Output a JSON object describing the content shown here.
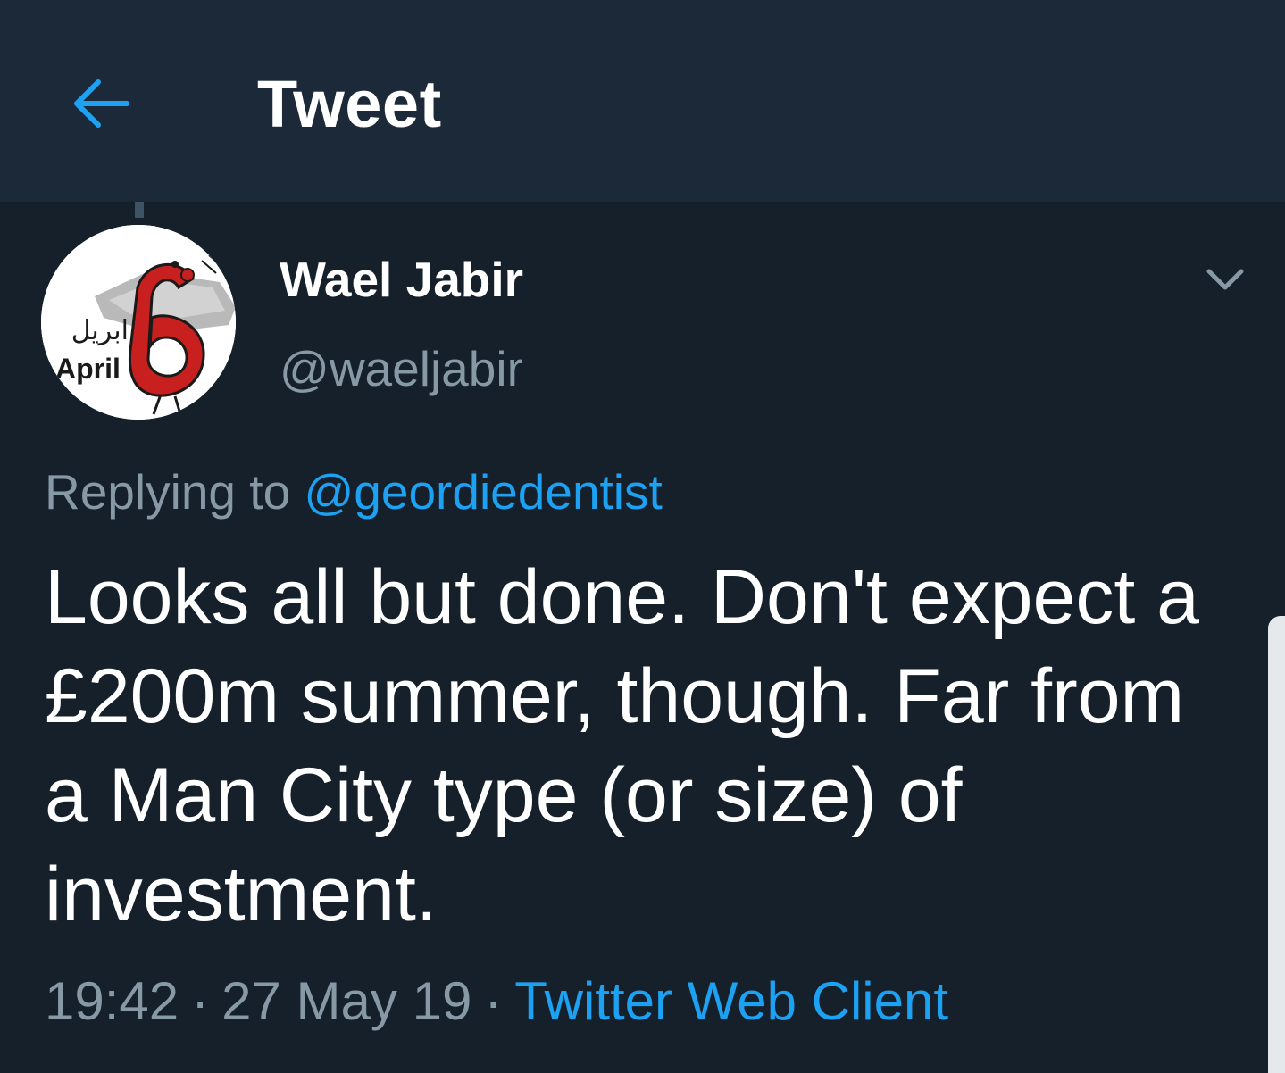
{
  "header": {
    "title": "Tweet",
    "back_icon": "arrow-left-icon"
  },
  "colors": {
    "background": "#15202b",
    "header_background": "#1c2938",
    "accent": "#1da1f2",
    "secondary_text": "#8899a6",
    "primary_text": "#ffffff"
  },
  "tweet": {
    "author": {
      "name": "Wael Jabir",
      "handle": "@waeljabir",
      "avatar_logo": {
        "arabic_text": "ابريل",
        "latin_text": "April",
        "numeral": "6"
      }
    },
    "menu_icon": "chevron-down-icon",
    "reply": {
      "prefix": "Replying to",
      "mention": "@geordiedentist"
    },
    "text": "Looks all but done. Don't expect a £200m summer, though. Far from a Man City type (or size) of investment.",
    "time": "19:42",
    "separator": "·",
    "date": "27 May 19",
    "source": "Twitter Web Client"
  }
}
